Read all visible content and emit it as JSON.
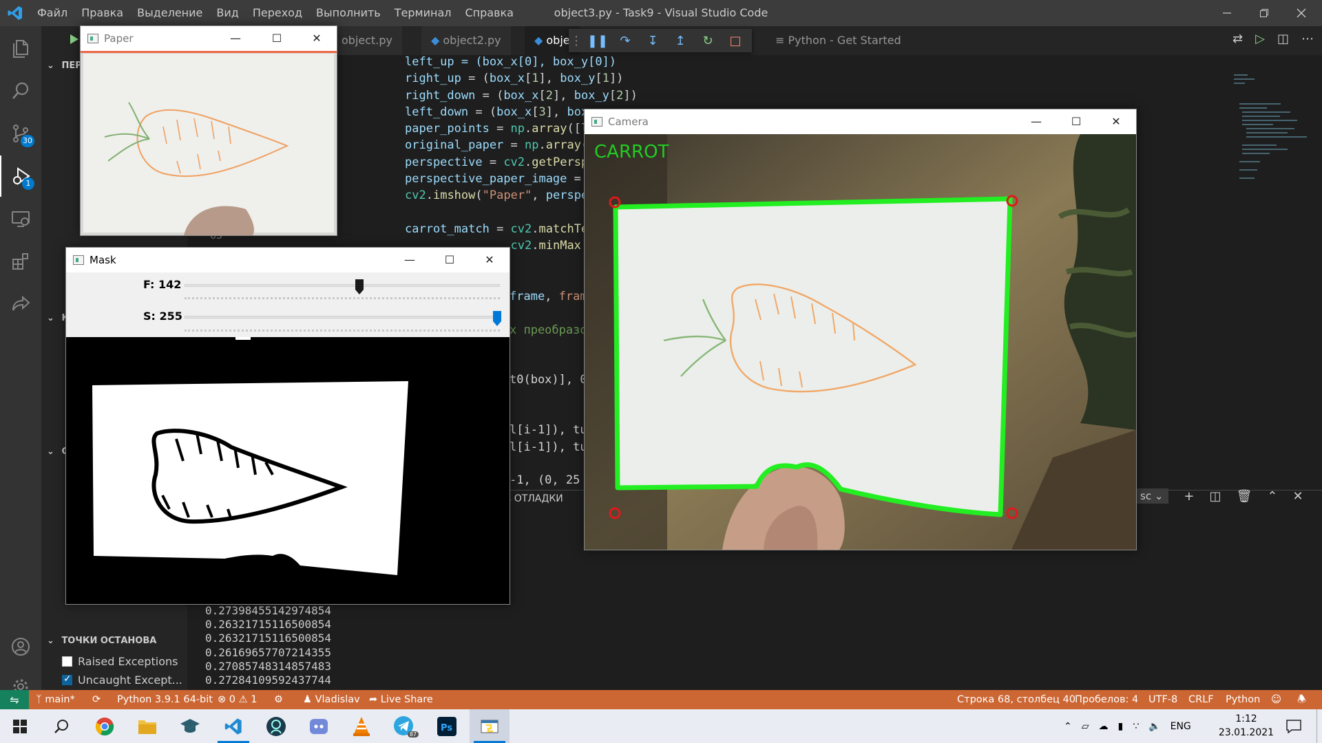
{
  "window": {
    "title": "object3.py - Task9 - Visual Studio Code",
    "menu": [
      "Файл",
      "Правка",
      "Выделение",
      "Вид",
      "Переход",
      "Выполнить",
      "Терминал",
      "Справка"
    ]
  },
  "activity": {
    "scm_badge": "30",
    "debug_badge": "1"
  },
  "sidebar": {
    "section1": "ПЕРЕ",
    "section2": "К",
    "section3": "С",
    "breakpoints_header": "ТОЧКИ ОСТАНОВА",
    "breakpoints": [
      {
        "label": "Raised Exceptions",
        "checked": false
      },
      {
        "label": "Uncaught Except...",
        "checked": true
      }
    ]
  },
  "tabs": [
    {
      "label": "object.py"
    },
    {
      "label": "object2.py"
    },
    {
      "label": "obje"
    },
    {
      "label": "Python - Get Started"
    }
  ],
  "code": {
    "lines": [
      "left_up = (box_x[0], box_y[0])",
      "right_up = (box_x[1], box_y[1])",
      "right_down = (box_x[2], box_y[2])",
      "left_down = (box_x[3], box_",
      "paper_points = np.array([le",
      "original_paper = np.array([",
      "perspective = cv2.getPerspe",
      "perspective_paper_image = c",
      "cv2.imshow(\"Paper\", perspec",
      "",
      "carrot_match = cv2.matchTem",
      "               cv2.minMax",
      "",
      "",
      "frame, \"CAR",
      "",
      "х преобразо",
      "",
      "",
      "t0(box)], 0",
      "",
      "",
      "l[i-1]), tu",
      "l[i-1]), tu",
      "",
      "-1, (0, 25"
    ],
    "line_number_visible": "65",
    "minimap_label": ""
  },
  "panel": {
    "title_fragment": "ь ОТЛАДКИ",
    "terminal_select": "sc",
    "terminal_lines": [
      "0.27398455142974854",
      "0.26321715116500854",
      "0.26321715116500854",
      "0.26169657707214355",
      "0.27085748314857483",
      "0.27284109592437744"
    ]
  },
  "statusbar": {
    "branch": "main*",
    "python": "Python 3.9.1 64-bit",
    "problems": "0",
    "warnings": "1",
    "user": "Vladislav",
    "live_share": "Live Share",
    "position": "Строка 68, столбец 40",
    "spaces": "Пробелов: 4",
    "encoding": "UTF-8",
    "eol": "CRLF",
    "language": "Python"
  },
  "cv_windows": {
    "paper_title": "Paper",
    "mask_title": "Mask",
    "camera_title": "Camera",
    "camera_overlay_text": "CARROT",
    "sliders": [
      {
        "label": "F: 142",
        "value": 142,
        "max": 255
      },
      {
        "label": "S: 255",
        "value": 255,
        "max": 255
      }
    ]
  },
  "taskbar": {
    "lang": "ENG",
    "time": "1:12",
    "date": "23.01.2021",
    "telegram_badge": "87"
  },
  "colors": {
    "statusbar": "#cc6633",
    "remote": "#16825d",
    "accent": "#007acc",
    "contour_green": "#22ee22",
    "corner_red": "#e0191a"
  }
}
